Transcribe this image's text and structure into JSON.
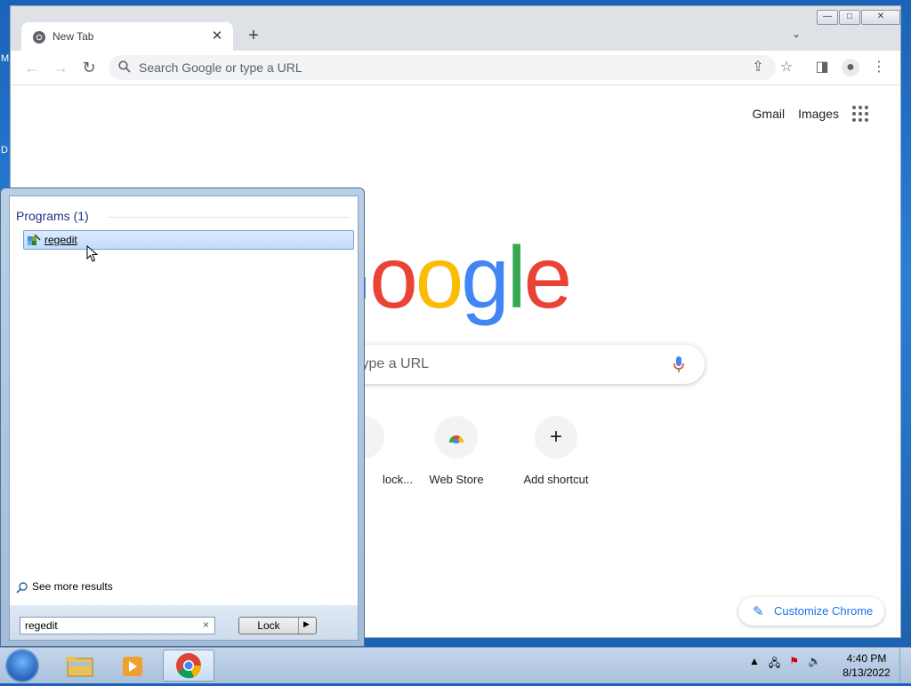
{
  "desktop": {
    "edge_letters": [
      "M",
      "D"
    ]
  },
  "browser": {
    "tab": {
      "title": "New Tab",
      "close": "✕"
    },
    "new_tab": "+",
    "omnibox": {
      "placeholder": "Search Google or type a URL"
    },
    "window_controls": {
      "minimize": "—",
      "maximize": "□",
      "close": "✕"
    }
  },
  "ntp": {
    "links": {
      "gmail": "Gmail",
      "images": "Images"
    },
    "logo": [
      "G",
      "o",
      "o",
      "g",
      "l",
      "e"
    ],
    "logo_colors": [
      "#4285f4",
      "#ea4335",
      "#fbbc05",
      "#4285f4",
      "#34a853",
      "#ea4335"
    ],
    "search_placeholder": "type a URL",
    "shortcuts": [
      {
        "label": "lock..."
      },
      {
        "label": "Web Store"
      },
      {
        "label": "Add shortcut",
        "glyph": "+"
      }
    ],
    "customize": "Customize Chrome"
  },
  "start_menu": {
    "section_header": "Programs (1)",
    "results": [
      {
        "label": "regedit",
        "icon": "regedit-icon"
      }
    ],
    "see_more": "See more results",
    "search_value": "regedit",
    "clear": "×",
    "shutdown_button": "Lock"
  },
  "taskbar": {
    "pinned": [
      "windows-explorer-icon",
      "media-player-icon",
      "chrome-icon"
    ],
    "clock": {
      "time": "4:40 PM",
      "date": "8/13/2022"
    }
  }
}
